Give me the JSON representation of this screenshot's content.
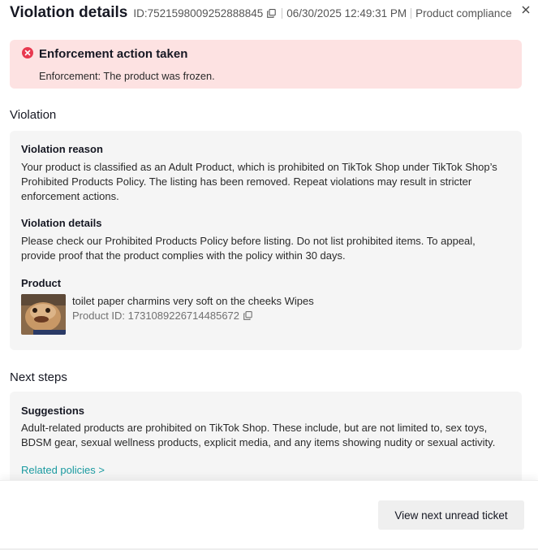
{
  "header": {
    "title": "Violation details",
    "ticket_id": "ID:7521598009252888845",
    "datetime": "06/30/2025 12:49:31 PM",
    "category": "Product compliance",
    "close_label": "×"
  },
  "alert": {
    "title": "Enforcement action taken",
    "body": "Enforcement: The product was frozen."
  },
  "violation": {
    "section_title": "Violation",
    "reason_label": "Violation reason",
    "reason_text": "Your product is classified as an Adult Product, which is prohibited on TikTok Shop under TikTok Shop’s Prohibited Products Policy. The listing has been removed. Repeat violations may result in stricter enforcement actions.",
    "details_label": "Violation details",
    "details_text": "Please check our Prohibited Products Policy before listing. Do not list prohibited items. To appeal, provide proof that the product complies with the policy within 30 days.",
    "product_label": "Product",
    "product_name": "toilet paper charmins very soft on the cheeks Wipes",
    "product_id": "Product ID: 1731089226714485672"
  },
  "next_steps": {
    "section_title": "Next steps",
    "suggestions_label": "Suggestions",
    "suggestions_text": "Adult-related products are prohibited on TikTok Shop. These include, but are not limited to, sex toys, BDSM gear, sexual wellness products, explicit media, and any items showing nudity or sexual activity.",
    "related_link": "Related policies >"
  },
  "footer": {
    "primary_button": "View next unread ticket"
  },
  "colors": {
    "alert_bg": "#fde2e2",
    "error_icon": "#e8384f",
    "card_bg": "#f5f5f5",
    "link": "#1a9aa0"
  }
}
